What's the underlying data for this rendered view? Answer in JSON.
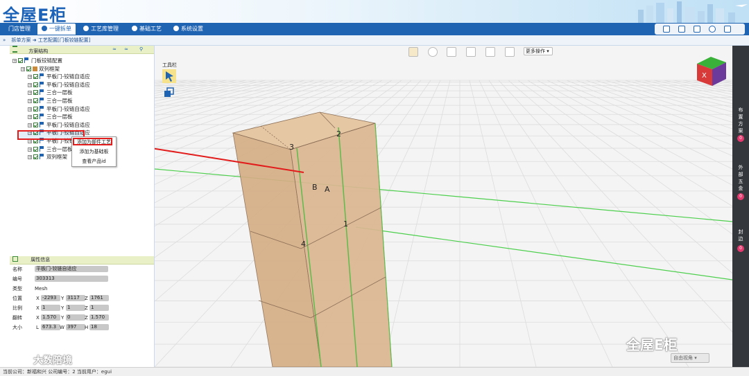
{
  "header": {
    "logo": "全屋E柜",
    "nav_tabs": [
      "门店管理",
      "一键拆单",
      "工艺库管理",
      "基础工艺",
      "系统设置"
    ],
    "active_tab": 1
  },
  "breadcrumb": "拆单方案 ➜ 工艺配置[门板铰链配置]",
  "tree_panel": {
    "title": "方案结构",
    "rows": [
      {
        "label": "门板铰链配置",
        "level": 0,
        "icon": "flag"
      },
      {
        "label": "双列框架",
        "level": 1,
        "icon": "box"
      },
      {
        "label": "平板门-铰链自适应",
        "level": 2,
        "icon": "flag"
      },
      {
        "label": "平板门-铰链自适应",
        "level": 2,
        "icon": "flag"
      },
      {
        "label": "三合一层板",
        "level": 2,
        "icon": "flag"
      },
      {
        "label": "三合一层板",
        "level": 2,
        "icon": "flag"
      },
      {
        "label": "平板门-铰链自适应",
        "level": 2,
        "icon": "flag"
      },
      {
        "label": "三合一层板",
        "level": 2,
        "icon": "flag"
      },
      {
        "label": "平板门-铰链自适应",
        "level": 2,
        "icon": "flag"
      },
      {
        "label": "平板门-铰链自适应",
        "level": 2,
        "icon": "flag"
      },
      {
        "label": "平板门-铰链",
        "level": 2,
        "icon": "flag"
      },
      {
        "label": "三合一层板",
        "level": 2,
        "icon": "flag"
      },
      {
        "label": "双列框架",
        "level": 2,
        "icon": "flag"
      }
    ],
    "context_menu": [
      "添加为部件工艺",
      "添加为基础板",
      "查看产品id"
    ]
  },
  "property_panel": {
    "title": "属性信息",
    "name_label": "名称",
    "name_value": "平板门-铰链自适应",
    "code_label": "编号",
    "code_value": "303313",
    "type_label": "类型",
    "type_value": "Mesh",
    "position_label": "位置",
    "position": {
      "x": "-2293",
      "y": "3117",
      "z": "1761"
    },
    "scale_label": "比例",
    "scale": {
      "x": "1",
      "y": "1",
      "z": "1"
    },
    "rotation_label": "翻转",
    "rotation": {
      "x": "1.570",
      "y": "0",
      "z": "1.570"
    },
    "size_label": "大小",
    "size": {
      "l": "673.3",
      "w": "397",
      "h": "18"
    }
  },
  "viewport": {
    "more_ops": "更多操作",
    "toolbox_title": "工具栏",
    "view_mode": "自由视角",
    "cube_face": "X",
    "labels": [
      "1",
      "2",
      "3",
      "4",
      "A",
      "B"
    ]
  },
  "right_sidebar": [
    {
      "label": "布置方案",
      "count": "0"
    },
    {
      "label": "外部五金",
      "count": "0"
    },
    {
      "label": "封边",
      "count": "0"
    }
  ],
  "status": "当前公司：新福和兴  公司编号：2  当前用户：egui",
  "watermarks": [
    "全屋E柜",
    "大数陪境"
  ],
  "colors": {
    "nav": "#1f63b3",
    "cabinet": "#d9b58f",
    "badge": "#e53a6f",
    "highlight": "#e21b1b"
  }
}
